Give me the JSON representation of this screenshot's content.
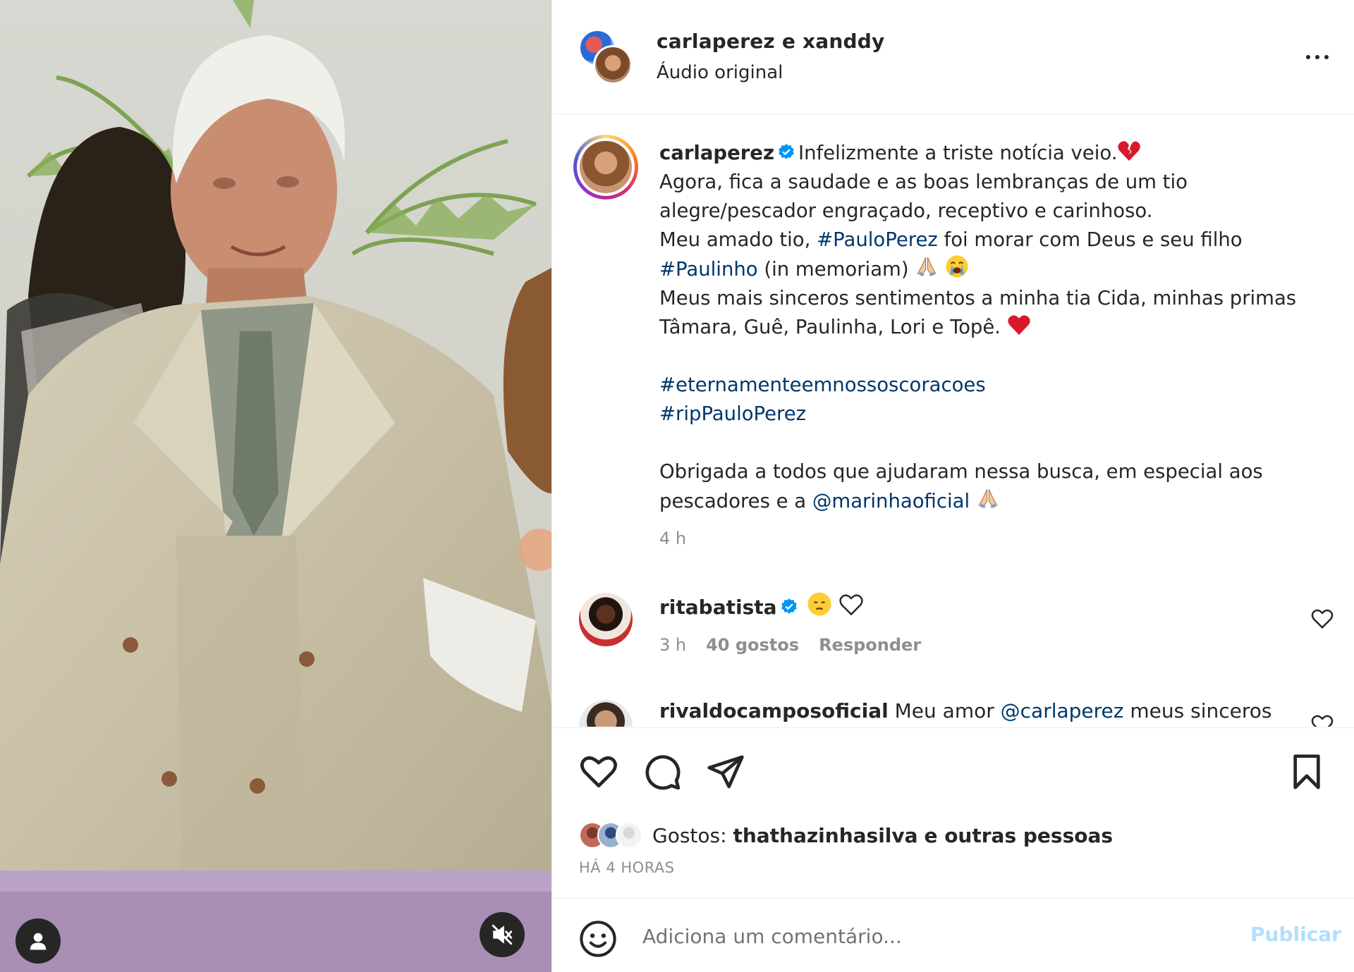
{
  "header": {
    "username": "carlaperez e xanddy",
    "audio_label": "Áudio original"
  },
  "caption": {
    "username": "carlaperez",
    "lines": [
      "Infelizmente a triste notícia veio.",
      "Agora, fica a saudade e as boas lembranças de um tio",
      "alegre/pescador engraçado, receptivo e carinhoso.",
      "Meu amado tio,",
      "#PauloPerez",
      "foi morar com Deus e seu filho",
      "#Paulinho",
      "(in memoriam)",
      "Meus mais sinceros sentimentos a minha tia Cida, minhas primas",
      "Tâmara, Guê, Paulinha, Lori e Topê.",
      "#eternamenteemnossoscoracoes",
      "#ripPauloPerez",
      "Obrigada a todos que ajudaram nessa busca, em especial aos",
      "pescadores e a",
      "@marinhaoficial"
    ],
    "time": "4 h"
  },
  "comments": [
    {
      "username": "ritabatista",
      "time": "3 h",
      "likes": "40 gostos",
      "reply": "Responder"
    },
    {
      "username": "rivaldocamposoficial",
      "text_before": "Meu amor",
      "mention": "@carlaperez",
      "text_after": "meus sinceros"
    }
  ],
  "likes": {
    "prefix": "Gostos:",
    "user": "thathazinhasilva",
    "suffix": "e outras pessoas"
  },
  "time_ago": "HÁ 4 HORAS",
  "comment_box": {
    "placeholder": "Adiciona um comentário...",
    "publish": "Publicar"
  },
  "icons": {
    "verified": "verified-badge-icon",
    "like": "heart-icon",
    "comment": "comment-icon",
    "share": "share-icon",
    "save": "bookmark-icon",
    "emoji": "smiley-icon",
    "mute": "muted-speaker-icon",
    "tags": "user-icon"
  },
  "colors": {
    "link": "#00376b",
    "verified": "#0095f6",
    "publish_disabled": "#b2dffc",
    "muted_text": "#8e8e8e"
  }
}
